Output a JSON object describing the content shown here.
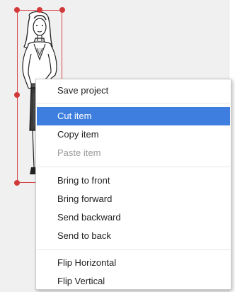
{
  "context_menu": {
    "groups": [
      [
        {
          "label": "Save project",
          "state": "normal"
        }
      ],
      [
        {
          "label": "Cut item",
          "state": "highlighted"
        },
        {
          "label": "Copy item",
          "state": "normal"
        },
        {
          "label": "Paste item",
          "state": "disabled"
        }
      ],
      [
        {
          "label": "Bring to front",
          "state": "normal"
        },
        {
          "label": "Bring forward",
          "state": "normal"
        },
        {
          "label": "Send backward",
          "state": "normal"
        },
        {
          "label": "Send to back",
          "state": "normal"
        }
      ],
      [
        {
          "label": "Flip Horizontal",
          "state": "normal"
        },
        {
          "label": "Flip Vertical",
          "state": "normal"
        }
      ]
    ]
  },
  "selection": {
    "color": "#d23a3a"
  },
  "colors": {
    "highlight": "#3d7ede",
    "disabled_text": "#9a9a9a"
  }
}
